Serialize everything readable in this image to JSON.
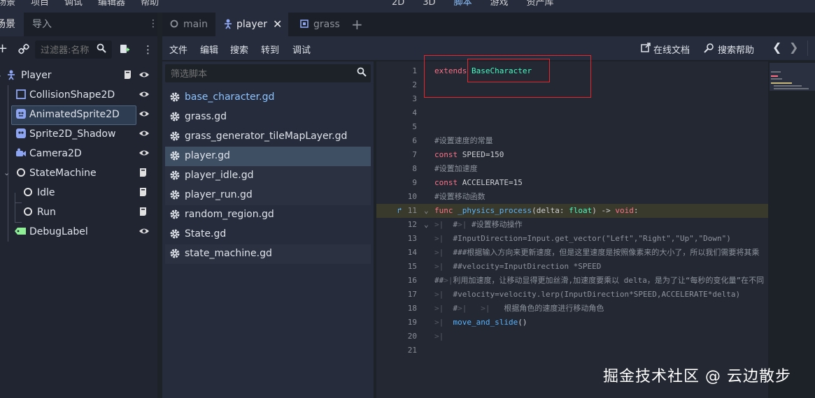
{
  "topbar": {
    "menus": [
      "场景",
      "项目",
      "调试",
      "编辑器",
      "帮助"
    ],
    "center": [
      "2D",
      "3D",
      "脚本",
      "游戏",
      "资产库"
    ]
  },
  "scene_dock": {
    "tabs": [
      "场景",
      "导入"
    ],
    "filter_placeholder": "过滤器:名称",
    "nodes": [
      {
        "label": "Player",
        "icon": "character-body-icon",
        "color": "#8da5f3"
      },
      {
        "label": "CollisionShape2D",
        "icon": "collision-shape-icon",
        "color": "#8da5f3"
      },
      {
        "label": "AnimatedSprite2D",
        "icon": "animated-sprite-icon",
        "color": "#8da5f3"
      },
      {
        "label": "Sprite2D_Shadow",
        "icon": "sprite-icon",
        "color": "#8da5f3"
      },
      {
        "label": "Camera2D",
        "icon": "camera-icon",
        "color": "#8da5f3"
      },
      {
        "label": "StateMachine",
        "icon": "node-icon",
        "color": "#e0e0e0"
      },
      {
        "label": "Idle",
        "icon": "node-icon",
        "color": "#e0e0e0"
      },
      {
        "label": "Run",
        "icon": "node-icon",
        "color": "#e0e0e0"
      },
      {
        "label": "DebugLabel",
        "icon": "label-icon",
        "color": "#8eef97"
      }
    ]
  },
  "editor": {
    "tabs": [
      "main",
      "player",
      "grass"
    ],
    "menus": [
      "文件",
      "编辑",
      "搜索",
      "转到",
      "调试"
    ],
    "online_docs": "在线文档",
    "search_help": "搜索帮助",
    "script_filter_placeholder": "筛选脚本",
    "files": [
      "base_character.gd",
      "grass.gd",
      "grass_generator_tileMapLayer.gd",
      "player.gd",
      "player_idle.gd",
      "player_run.gd",
      "random_region.gd",
      "State.gd",
      "state_machine.gd"
    ],
    "line_numbers": [
      "1",
      "2",
      "3",
      "4",
      "5",
      "6",
      "7",
      "8",
      "9",
      "10",
      "11",
      "12",
      "13",
      "14",
      "15",
      "16",
      "17",
      "18",
      "19",
      "20",
      "21"
    ],
    "code": {
      "l1_kw": "extends",
      "l1_type": "BaseCharacter",
      "l6": "#设置速度的常量",
      "l7_kw": "const",
      "l7_rest": "SPEED=150",
      "l8": "#设置加速度",
      "l9_kw": "const",
      "l9_rest": "ACCELERATE=15",
      "l10": "#设置移动函数",
      "l11_kw": "func",
      "l11_fn": "_physics_process",
      "l11_a": "(delta: ",
      "l11_type": "float",
      "l11_b": ") -> ",
      "l11_void": "void",
      "l11_c": ":",
      "l12": "#设置移动操作",
      "l13": "#InputDirection=Input.get_vector(\"Left\",\"Right\",\"Up\",\"Down\")",
      "l14": "###根据输入方向来更新速度，但是这里速度是按照像素来的大小了，所以我们需要将其乘",
      "l15": "##velocity=InputDirection *SPEED",
      "l16": "利用加速度，让移动显得更加丝滑,加速度要乘以 delta，是为了让“每秒的变化量”在不同",
      "l16_prefix": "##",
      "l17": "#velocity=velocity.lerp(InputDirection*SPEED,ACCELERATE*delta)",
      "l18": "根据角色的速度进行移动角色",
      "l18_prefix": "#",
      "l19_fn": "move_and_slide",
      "l19_rest": "()"
    }
  },
  "watermark": "掘金技术社区 @ 云边散步",
  "colors": {
    "accent_red": "#e5262b",
    "keyword": "#ff7085",
    "type": "#42ffc2",
    "function": "#57b3ff"
  }
}
